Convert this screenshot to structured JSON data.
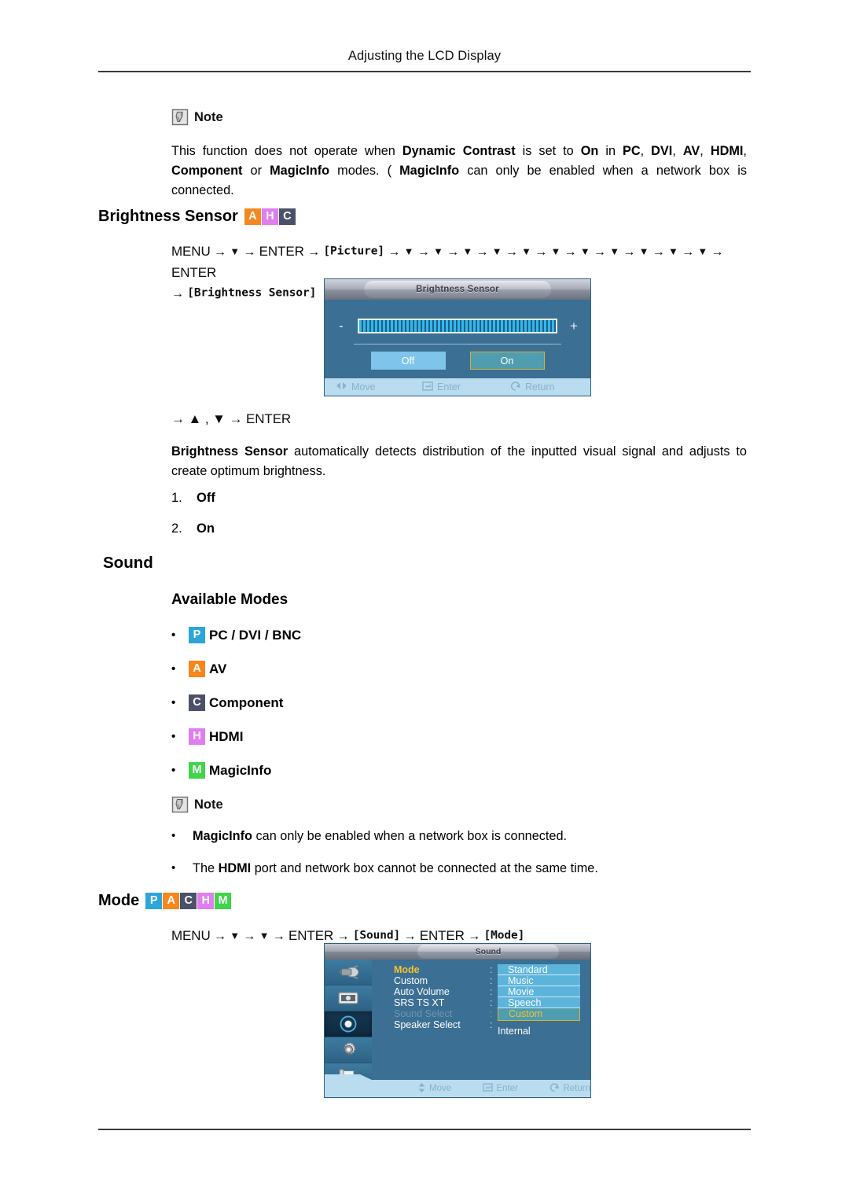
{
  "header": {
    "title": "Adjusting the LCD Display"
  },
  "note1": {
    "label": "Note",
    "text_parts": [
      {
        "t": "This function does not operate when ",
        "b": false
      },
      {
        "t": "Dynamic Contrast",
        "b": true
      },
      {
        "t": " is set to ",
        "b": false
      },
      {
        "t": "On",
        "b": true
      },
      {
        "t": " in ",
        "b": false
      },
      {
        "t": "PC",
        "b": true
      },
      {
        "t": ", ",
        "b": false
      },
      {
        "t": "DVI",
        "b": true
      },
      {
        "t": ", ",
        "b": false
      },
      {
        "t": "AV",
        "b": true
      },
      {
        "t": ", ",
        "b": false
      },
      {
        "t": "HDMI",
        "b": true
      },
      {
        "t": ", ",
        "b": false
      },
      {
        "t": "Component",
        "b": true
      },
      {
        "t": " or ",
        "b": false
      },
      {
        "t": "MagicInfo",
        "b": true
      },
      {
        "t": " modes. ( ",
        "b": false
      },
      {
        "t": "MagicInfo",
        "b": true
      },
      {
        "t": " can only be enabled when a network box is connected.",
        "b": false
      }
    ]
  },
  "brightness_sensor": {
    "heading": "Brightness Sensor",
    "badges": [
      {
        "letter": "A",
        "color": "#f6871f"
      },
      {
        "letter": "H",
        "color": "#e07ef0"
      },
      {
        "letter": "C",
        "color": "#4b5168"
      }
    ],
    "menu_path_line1": "MENU → ▼ → ENTER → [Picture] → ▼ → ▼ → ▼ → ▼ → ▼ → ▼ → ▼ → ▼ → ▼ → ▼ → ▼ → ENTER",
    "menu_path_line2": "→ [Brightness Sensor]",
    "path_tokens": [
      "MENU",
      "ENTER",
      "Picture",
      "ENTER",
      "Brightness Sensor"
    ],
    "down_arrow_count": 11,
    "after_path": "→ ▲ , ▼ → ENTER",
    "description_parts": [
      {
        "t": "Brightness Sensor",
        "b": true
      },
      {
        "t": " automatically detects distribution of the inputted visual signal and adjusts to create optimum brightness.",
        "b": false
      }
    ],
    "options": [
      {
        "num": "1.",
        "label": "Off"
      },
      {
        "num": "2.",
        "label": "On"
      }
    ],
    "osd": {
      "title": "Brightness Sensor",
      "minus": "-",
      "plus": "+",
      "slider_percent": 100,
      "buttons": [
        {
          "label": "Off",
          "state": "normal"
        },
        {
          "label": "On",
          "state": "selected"
        }
      ],
      "footer": [
        {
          "icon": "left-right-arrows-icon",
          "label": "Move"
        },
        {
          "icon": "enter-key-icon",
          "label": "Enter"
        },
        {
          "icon": "return-arrow-icon",
          "label": "Return"
        }
      ]
    }
  },
  "sound": {
    "heading": "Sound",
    "available_modes_heading": "Available Modes",
    "modes": [
      {
        "badge": "P",
        "color": "#2ca6d9",
        "label": "PC / DVI / BNC"
      },
      {
        "badge": "A",
        "color": "#f6871f",
        "label": "AV"
      },
      {
        "badge": "C",
        "color": "#4b5168",
        "label": "Component"
      },
      {
        "badge": "H",
        "color": "#e07ef0",
        "label": "HDMI"
      },
      {
        "badge": "M",
        "color": "#3fd44a",
        "label": "MagicInfo"
      }
    ],
    "note": {
      "label": "Note",
      "bullets": [
        [
          {
            "t": "MagicInfo",
            "b": true
          },
          {
            "t": " can only be enabled when a network box is connected.",
            "b": false
          }
        ],
        [
          {
            "t": "The ",
            "b": false
          },
          {
            "t": "HDMI",
            "b": true
          },
          {
            "t": " port and network box cannot be connected at the same time.",
            "b": false
          }
        ]
      ]
    }
  },
  "mode": {
    "heading": "Mode",
    "badges": [
      {
        "letter": "P",
        "color": "#2ca6d9"
      },
      {
        "letter": "A",
        "color": "#f6871f"
      },
      {
        "letter": "C",
        "color": "#4b5168"
      },
      {
        "letter": "H",
        "color": "#e07ef0"
      },
      {
        "letter": "M",
        "color": "#3fd44a"
      }
    ],
    "menu_path": "MENU → ▼ → ▼ → ENTER → [Sound] → ENTER → [Mode]",
    "osd": {
      "title": "Sound",
      "sidebar_icons": [
        "input-source-icon",
        "picture-icon",
        "sound-icon",
        "setup-gear-icon",
        "multi-control-icon"
      ],
      "active_sidebar_index": 2,
      "rows": [
        {
          "label": "Mode",
          "state": "selected",
          "colon": ":"
        },
        {
          "label": "Custom",
          "state": "normal",
          "colon": ":"
        },
        {
          "label": "Auto Volume",
          "state": "normal",
          "colon": ":"
        },
        {
          "label": "SRS TS XT",
          "state": "normal",
          "colon": ":"
        },
        {
          "label": "Sound Select",
          "state": "disabled",
          "colon": ":"
        },
        {
          "label": "Speaker Select",
          "state": "normal",
          "colon": ":"
        }
      ],
      "options": [
        {
          "label": "Standard",
          "current": false
        },
        {
          "label": "Music",
          "current": false
        },
        {
          "label": "Movie",
          "current": false
        },
        {
          "label": "Speech",
          "current": false
        },
        {
          "label": "Custom",
          "current": true
        }
      ],
      "speaker_select_value": "Internal",
      "footer": [
        {
          "icon": "up-down-arrows-icon",
          "label": "Move"
        },
        {
          "icon": "enter-key-icon",
          "label": "Enter"
        },
        {
          "icon": "return-arrow-icon",
          "label": "Return"
        }
      ]
    }
  }
}
